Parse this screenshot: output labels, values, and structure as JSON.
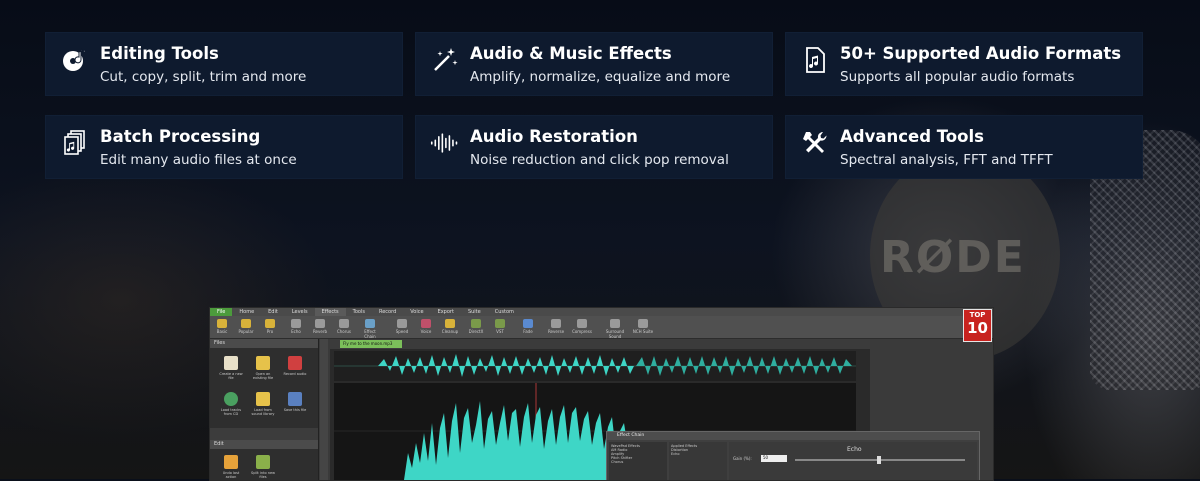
{
  "features": [
    {
      "title": "Editing Tools",
      "desc": "Cut, copy, split, trim and more",
      "icon": "disc-music-icon"
    },
    {
      "title": "Audio & Music Effects",
      "desc": "Amplify, normalize, equalize and more",
      "icon": "magic-wand-icon"
    },
    {
      "title": "50+ Supported Audio Formats",
      "desc": "Supports all popular audio formats",
      "icon": "audio-file-icon"
    },
    {
      "title": "Batch Processing",
      "desc": "Edit many audio files at once",
      "icon": "stacked-files-icon"
    },
    {
      "title": "Audio Restoration",
      "desc": "Noise reduction and click pop removal",
      "icon": "waveform-icon"
    },
    {
      "title": "Advanced Tools",
      "desc": "Spectral analysis, FFT and TFFT",
      "icon": "tools-icon"
    }
  ],
  "background": {
    "logo_text": "RØDE"
  },
  "app": {
    "menu": [
      "File",
      "Home",
      "Edit",
      "Levels",
      "Effects",
      "Tools",
      "Record",
      "Voice",
      "Export",
      "Suite",
      "Custom"
    ],
    "active_menu": "Effects",
    "ribbon": [
      "Basic",
      "Popular",
      "Pro",
      "Echo",
      "Reverb",
      "Chorus",
      "Effect Chain",
      "Speed",
      "Voice",
      "Cleanup",
      "DirectX",
      "VST",
      "Fade",
      "Reverse",
      "Compress",
      "Surround Sound",
      "NCH Suite"
    ],
    "files_panel": {
      "header": "Files",
      "buttons": [
        "Create a new file",
        "Open an existing file",
        "Record audio",
        "Load tracks from CD",
        "Load from sound library",
        "Save this file"
      ]
    },
    "edit_panel": {
      "header": "Edit",
      "buttons": [
        "Undo last action",
        "Split into new files"
      ]
    },
    "tab_label": "Fly me to the moon.mp3",
    "dialog": {
      "title": "Effect Chain",
      "list_header": "WavePad Effects",
      "list_items": [
        "AM Radio",
        "Amplify",
        "Pitch Shifter",
        "Chorus"
      ],
      "applied_header": "Applied Effects",
      "applied_items": [
        "Distortion",
        "Echo"
      ],
      "effect_name": "Echo",
      "gain_label": "Gain (%):",
      "gain_value": "50"
    },
    "badge_top": "TOP",
    "badge_num": "10"
  },
  "colors": {
    "card_bg": "#0e1a2e",
    "waveform": "#3ed6c6",
    "accent_green": "#4c9b3c",
    "badge_red": "#c8231f"
  }
}
